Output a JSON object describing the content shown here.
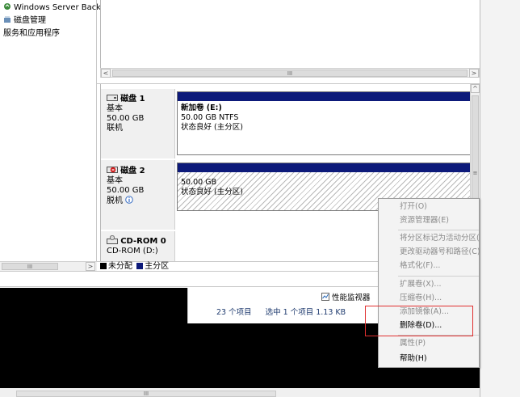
{
  "tree": {
    "items": [
      {
        "label": "Windows Server Back",
        "icon": "backup-icon"
      },
      {
        "label": "磁盘管理",
        "icon": "disk-management-icon"
      },
      {
        "label": "服务和应用程序",
        "icon": ""
      }
    ]
  },
  "scroll": {
    "thumb_label": "III",
    "left_arrow": "<",
    "right_arrow": ">",
    "up_arrow": "^",
    "grip": "≡"
  },
  "disks": [
    {
      "name": "磁盘 1",
      "icon": "disk-icon",
      "type": "基本",
      "size": "50.00 GB",
      "status": "联机",
      "partition": {
        "title": "新加卷 (E:)",
        "size_fs": "50.00 GB NTFS",
        "state": "状态良好 (主分区)"
      }
    },
    {
      "name": "磁盘 2",
      "icon": "disk-offline-icon",
      "type": "基本",
      "size": "50.00 GB",
      "status": "脱机",
      "status_icon": "info-icon",
      "partition": {
        "title": "",
        "size_fs": "50.00 GB",
        "state": "状态良好 (主分区)"
      }
    },
    {
      "name": "CD-ROM 0",
      "icon": "cdrom-icon",
      "type": "CD-ROM (D:)"
    }
  ],
  "legend": [
    {
      "label": "未分配",
      "color": "#000000"
    },
    {
      "label": "主分区",
      "color": "#0d1a7a"
    }
  ],
  "explorer": {
    "perf_label": "性能监视器",
    "item_count": "23 个项目",
    "selected": "选中 1 个项目  1.13 KB"
  },
  "context_menu": {
    "items": [
      {
        "label": "打开(O)",
        "disabled": true
      },
      {
        "label": "资源管理器(E)",
        "disabled": true
      },
      {
        "label": "将分区标记为活动分区(",
        "disabled": true
      },
      {
        "label": "更改驱动器号和路径(C)",
        "disabled": true
      },
      {
        "label": "格式化(F)...",
        "disabled": true
      },
      {
        "label": "扩展卷(X)...",
        "disabled": true
      },
      {
        "label": "压缩卷(H)...",
        "disabled": true
      },
      {
        "label": "添加镜像(A)...",
        "disabled": true
      },
      {
        "label": "删除卷(D)...",
        "disabled": false
      },
      {
        "label": "属性(P)",
        "disabled": true
      },
      {
        "label": "帮助(H)",
        "disabled": false
      }
    ]
  },
  "colors": {
    "partition_bar": "#0d1a7a",
    "highlight_box": "#e03030"
  }
}
